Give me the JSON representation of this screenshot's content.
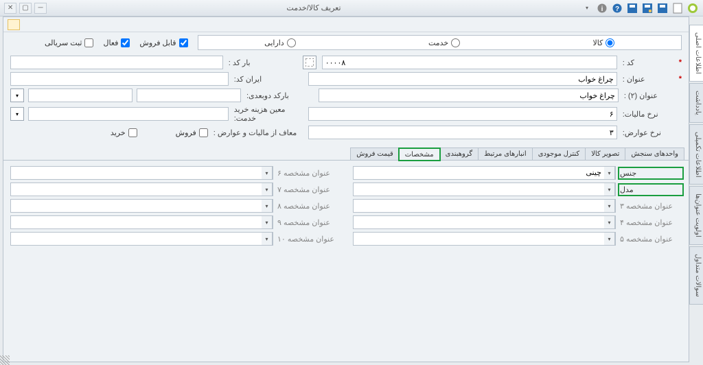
{
  "window": {
    "title": "تعریف کالا/خدمت"
  },
  "sideTabs": [
    "اطلاعات اصلی",
    "یادداشت",
    "اطلاعات تکمیلی",
    "اولویت عنوان‌ها",
    "سوالات متداول"
  ],
  "typeOptions": {
    "goods": "کالا",
    "service": "خدمت",
    "asset": "دارایی"
  },
  "flags": {
    "saleable": "قابل فروش",
    "active": "فعال",
    "serialReg": "ثبت سریالی"
  },
  "fields": {
    "codeLabel": "کد :",
    "codeValue": "۰۰۰۰۸",
    "titleLabel": "عنوان :",
    "titleValue": "چراغ خواب",
    "title2Label": "عنوان (۲) :",
    "title2Value": "چراغ خواب",
    "barcodeLabel": "بار کد :",
    "iranCodeLabel": "ایران کد:",
    "barcode2dLabel": "بارکد دوبعدی:",
    "moeinLabel": "معین هزینه خرید خدمت:",
    "taxRateLabel": "نرخ مالیات:",
    "taxRateValue": "۶",
    "feeRateLabel": "نرخ عوارض:",
    "feeRateValue": "۳",
    "exemptLabel": "معاف از مالیات و عوارض :",
    "saleChk": "فروش",
    "buyChk": "خرید"
  },
  "subTabs": [
    "واحدهای سنجش",
    "تصویر کالا",
    "کنترل موجودی",
    "انبارهای مرتبط",
    "گروهبندی",
    "مشخصات",
    "قیمت فروش"
  ],
  "specs": {
    "right": [
      {
        "label": "جنس",
        "value": "چینی",
        "hl": true,
        "dark": true
      },
      {
        "label": "مدل",
        "value": "",
        "hl": true,
        "dark": true
      },
      {
        "label": "عنوان مشخصه ۳",
        "value": ""
      },
      {
        "label": "عنوان مشخصه ۴",
        "value": ""
      },
      {
        "label": "عنوان مشخصه ۵",
        "value": ""
      }
    ],
    "left": [
      {
        "label": "عنوان مشخصه ۶",
        "value": ""
      },
      {
        "label": "عنوان مشخصه ۷",
        "value": ""
      },
      {
        "label": "عنوان مشخصه ۸",
        "value": ""
      },
      {
        "label": "عنوان مشخصه ۹",
        "value": ""
      },
      {
        "label": "عنوان مشخصه ۱۰",
        "value": ""
      }
    ]
  }
}
